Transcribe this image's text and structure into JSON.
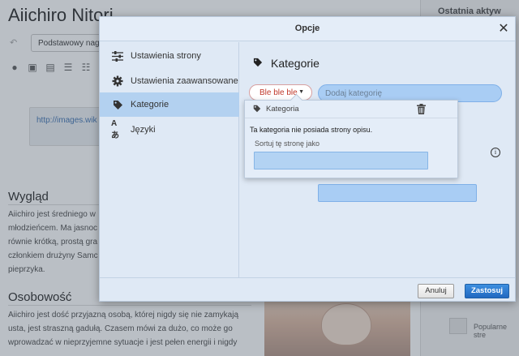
{
  "background": {
    "page_title": "Aiichiro Nitori",
    "format_select": "Podstawowy nagłówek",
    "image_url": "http://images.wik",
    "section1_heading": "Wygląd",
    "section1_text": "Aiichiro jest średniego w\nmłodzieńcem. Ma jasnoc\nrównie krótką, prostą gra\nczłonkiem drużyny Samc\npieprzyka.",
    "section2_heading": "Osobowość",
    "section2_text": "Aiichiro jest dość przyjazną osobą, której nigdy się nie zamykają\nusta, jest straszną gadułą. Czasem mówi za dużo, co może go\nwprowadzać w nieprzyjemne sytuacje i jest pełen energii i nigdy",
    "rail_title": "Ostatnia aktyw",
    "rail_item": "Popularne stre"
  },
  "dialog": {
    "title": "Opcje",
    "close_icon": "close-icon",
    "menu": [
      {
        "label": "Ustawienia strony",
        "icon": "sliders-icon"
      },
      {
        "label": "Ustawienia zaawansowane",
        "icon": "gear-icon"
      },
      {
        "label": "Kategorie",
        "icon": "tag-icon",
        "active": true
      },
      {
        "label": "Języki",
        "icon": "language-icon"
      }
    ],
    "categories": {
      "heading": "Kategorie",
      "chip_label": "Ble ble ble",
      "add_placeholder": "Dodaj kategorię",
      "popup": {
        "title": "Kategoria",
        "description": "Ta kategoria nie posiada strony opisu.",
        "sort_label": "Sortuj tę stronę jako",
        "sort_value": ""
      }
    },
    "footer": {
      "cancel_label": "Anuluj",
      "apply_label": "Zastosuj"
    }
  },
  "colors": {
    "accent": "#2168c0",
    "active_menu": "#b3d1f0",
    "chip_text": "#c0392b"
  }
}
